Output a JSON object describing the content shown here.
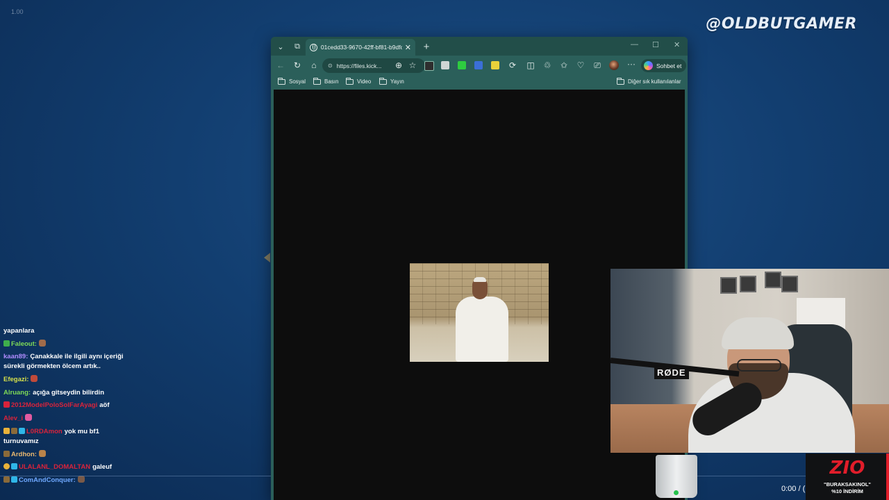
{
  "overlay": {
    "counter": "1.00",
    "watermark": "@OLDBUTGAMER"
  },
  "browser": {
    "tab_title": "01cedd33-9670-42ff-bf81-b9dfc2",
    "address": "https://files.kick...",
    "copilot_label": "Sohbet et",
    "favorites": [
      "Sosyal",
      "Basın",
      "Video",
      "Yayın"
    ],
    "other_favorites": "Diğer sık kullanılanlar",
    "theme_color": "#2b5f5a"
  },
  "webcam": {
    "mic_brand": "RØDE"
  },
  "chat": {
    "messages": [
      {
        "user": "",
        "user_color": "#ffffff",
        "text": "yapanlara"
      },
      {
        "user": "Faleout:",
        "user_color": "#7ed957",
        "text": ""
      },
      {
        "user": "kaan89:",
        "user_color": "#b08cff",
        "text": "Çanakkale ile ilgili aynı içeriği sürekli görmekten ölcem artık.."
      },
      {
        "user": "Efegazi:",
        "user_color": "#d6e04a",
        "text": ""
      },
      {
        "user": "Alruang:",
        "user_color": "#7ed957",
        "text": "açığa gitseydin bilirdin"
      },
      {
        "user": "2012ModelPoloSolFarAyagi",
        "user_color": "#d9233b",
        "text": "aöf"
      },
      {
        "user": "Alev_i",
        "user_color": "#d9233b",
        "text": ""
      },
      {
        "user": "L0RDAmon",
        "user_color": "#d9233b",
        "text": "yok mu bf1 turnuvamız"
      },
      {
        "user": "Ardhon:",
        "user_color": "#e9b870",
        "text": ""
      },
      {
        "user": "ULALANL_DOMALTAN",
        "user_color": "#d9233b",
        "text": "galeuf"
      },
      {
        "user": "ComAndConquer:",
        "user_color": "#6fa8ff",
        "text": ""
      }
    ]
  },
  "player": {
    "time": "0:00 / ("
  },
  "promo": {
    "brand": "ZIO",
    "code": "\"BURAKSAKINOL\"",
    "discount": "%10 İNDİRİM"
  }
}
